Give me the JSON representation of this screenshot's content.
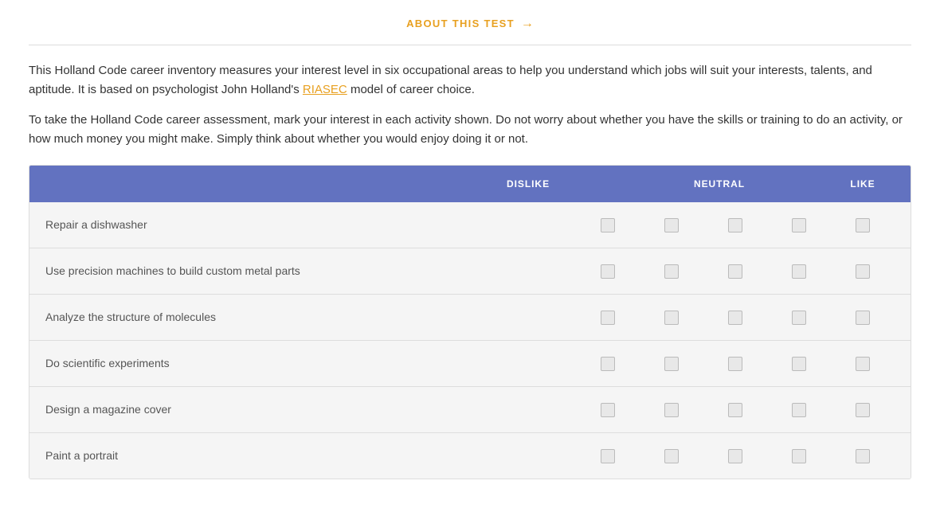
{
  "header": {
    "about_label": "ABOUT THIS TEST",
    "arrow": "→"
  },
  "intro": {
    "text1": "This Holland Code career inventory measures your interest level in six occupational areas to help you understand which jobs will suit your interests, talents, and aptitude. It is based on psychologist John Holland's ",
    "riasec_label": "RIASEC",
    "text2": " model of career choice.",
    "text3": "To take the Holland Code career assessment, mark your interest in each activity shown. Do not worry about whether you have the skills or training to do an activity, or how much money you might make. Simply think about whether you would enjoy doing it or not."
  },
  "table": {
    "columns": [
      {
        "label": "",
        "key": "empty"
      },
      {
        "label": "DISLIKE",
        "key": "dislike"
      },
      {
        "label": "",
        "key": "dislike2"
      },
      {
        "label": "NEUTRAL",
        "key": "neutral"
      },
      {
        "label": "",
        "key": "like1"
      },
      {
        "label": "LIKE",
        "key": "like"
      }
    ],
    "rows": [
      {
        "label": "Repair a dishwasher"
      },
      {
        "label": "Use precision machines to build custom metal parts"
      },
      {
        "label": "Analyze the structure of molecules"
      },
      {
        "label": "Do scientific experiments"
      },
      {
        "label": "Design a magazine cover"
      },
      {
        "label": "Paint a portrait"
      }
    ]
  }
}
